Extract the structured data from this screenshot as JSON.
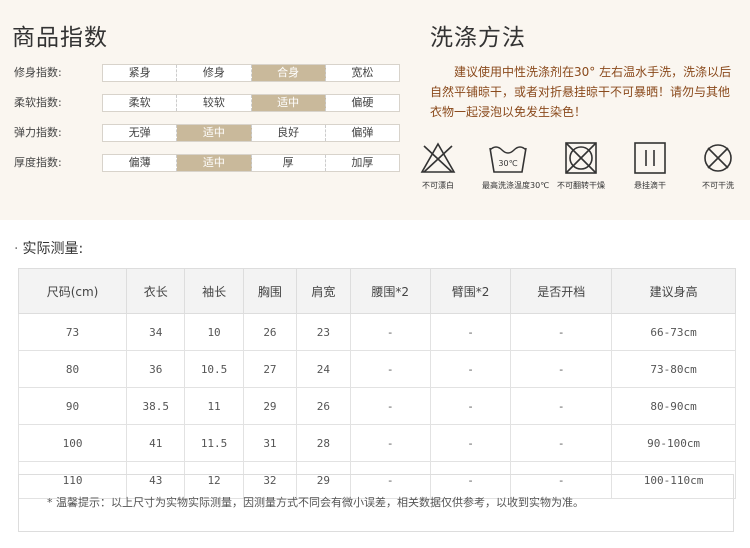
{
  "product_index": {
    "title": "商品指数",
    "rows": [
      {
        "label": "修身指数:",
        "options": [
          "紧身",
          "修身",
          "合身",
          "宽松"
        ],
        "selected": 2
      },
      {
        "label": "柔软指数:",
        "options": [
          "柔软",
          "较软",
          "适中",
          "偏硬"
        ],
        "selected": 2
      },
      {
        "label": "弹力指数:",
        "options": [
          "无弹",
          "适中",
          "良好",
          "偏弹"
        ],
        "selected": 1
      },
      {
        "label": "厚度指数:",
        "options": [
          "偏薄",
          "适中",
          "厚",
          "加厚"
        ],
        "selected": 1
      }
    ]
  },
  "washing": {
    "title": "洗涤方法",
    "description": "建议使用中性洗涤剂在30° 左右温水手洗，洗涤以后自然平铺晾干，或者对折悬挂晾干不可暴晒！请勿与其他衣物一起浸泡以免发生染色！",
    "icons": [
      {
        "name": "no-bleach-icon",
        "label": "不可漂白"
      },
      {
        "name": "wash-30-icon",
        "label": "最高洗涤温度30℃",
        "inner": "30℃"
      },
      {
        "name": "no-tumble-dry-icon",
        "label": "不可翻转干燥"
      },
      {
        "name": "drip-dry-icon",
        "label": "悬挂滴干"
      },
      {
        "name": "no-dry-clean-icon",
        "label": "不可干洗"
      }
    ]
  },
  "measurement": {
    "title": "实际测量:",
    "headers": [
      "尺码(cm)",
      "衣长",
      "袖长",
      "胸围",
      "肩宽",
      "腰围*2",
      "臂围*2",
      "是否开档",
      "建议身高"
    ],
    "rows": [
      [
        "73",
        "34",
        "10",
        "26",
        "23",
        "-",
        "-",
        "-",
        "66-73cm"
      ],
      [
        "80",
        "36",
        "10.5",
        "27",
        "24",
        "-",
        "-",
        "-",
        "73-80cm"
      ],
      [
        "90",
        "38.5",
        "11",
        "29",
        "26",
        "-",
        "-",
        "-",
        "80-90cm"
      ],
      [
        "100",
        "41",
        "11.5",
        "31",
        "28",
        "-",
        "-",
        "-",
        "90-100cm"
      ],
      [
        "110",
        "43",
        "12",
        "32",
        "29",
        "-",
        "-",
        "-",
        "100-110cm"
      ]
    ],
    "note": "*  温馨提示：以上尺寸为实物实际测量，因测量方式不同会有微小误差，相关数据仅供参考，以收到实物为准。"
  },
  "colors": {
    "selected_bg": "#c9b99b",
    "desc_text": "#8a4a1c",
    "panel_bg": "#faf6f0"
  }
}
